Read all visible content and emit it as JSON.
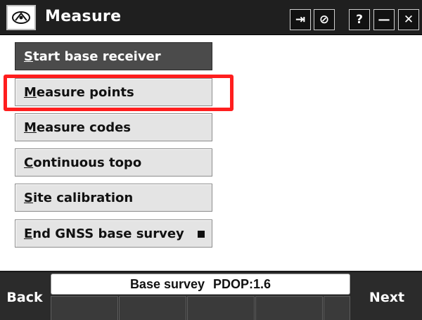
{
  "window": {
    "title": "Measure",
    "title_buttons": [
      {
        "icon": "enter-arrow-icon",
        "glyph": "⇥"
      },
      {
        "icon": "no-entry-icon",
        "glyph": "⊘"
      },
      {
        "icon": "help-icon",
        "glyph": "?"
      },
      {
        "icon": "minimize-icon",
        "glyph": "—"
      },
      {
        "icon": "close-icon",
        "glyph": "✕"
      }
    ]
  },
  "menu": {
    "items": [
      {
        "label": "Start base receiver",
        "hotkey": "S",
        "rest": "tart base receiver",
        "state": "selected"
      },
      {
        "label": "Measure points",
        "hotkey": "M",
        "rest": "easure points"
      },
      {
        "label": "Measure codes",
        "hotkey": "M",
        "rest": "easure codes"
      },
      {
        "label": "Continuous topo",
        "hotkey": "C",
        "rest": "ontinuous topo"
      },
      {
        "label": "Site calibration",
        "hotkey": "S",
        "rest": "ite calibration"
      },
      {
        "label": "End GNSS base survey",
        "hotkey": "E",
        "rest": "nd GNSS base survey",
        "indicator": "■"
      }
    ],
    "highlighted_item": "Measure points",
    "highlight_color": "#ff1e1e"
  },
  "bottom": {
    "status_label": "Base survey",
    "pdop_text": "PDOP:1.6",
    "back_label": "Back",
    "next_label": "Next"
  },
  "colors": {
    "titlebar": "#1f1f1f",
    "button_face": "#e4e4e4",
    "selected_face": "#4b4b4b",
    "softkey_bar": "#2a2a2a"
  }
}
